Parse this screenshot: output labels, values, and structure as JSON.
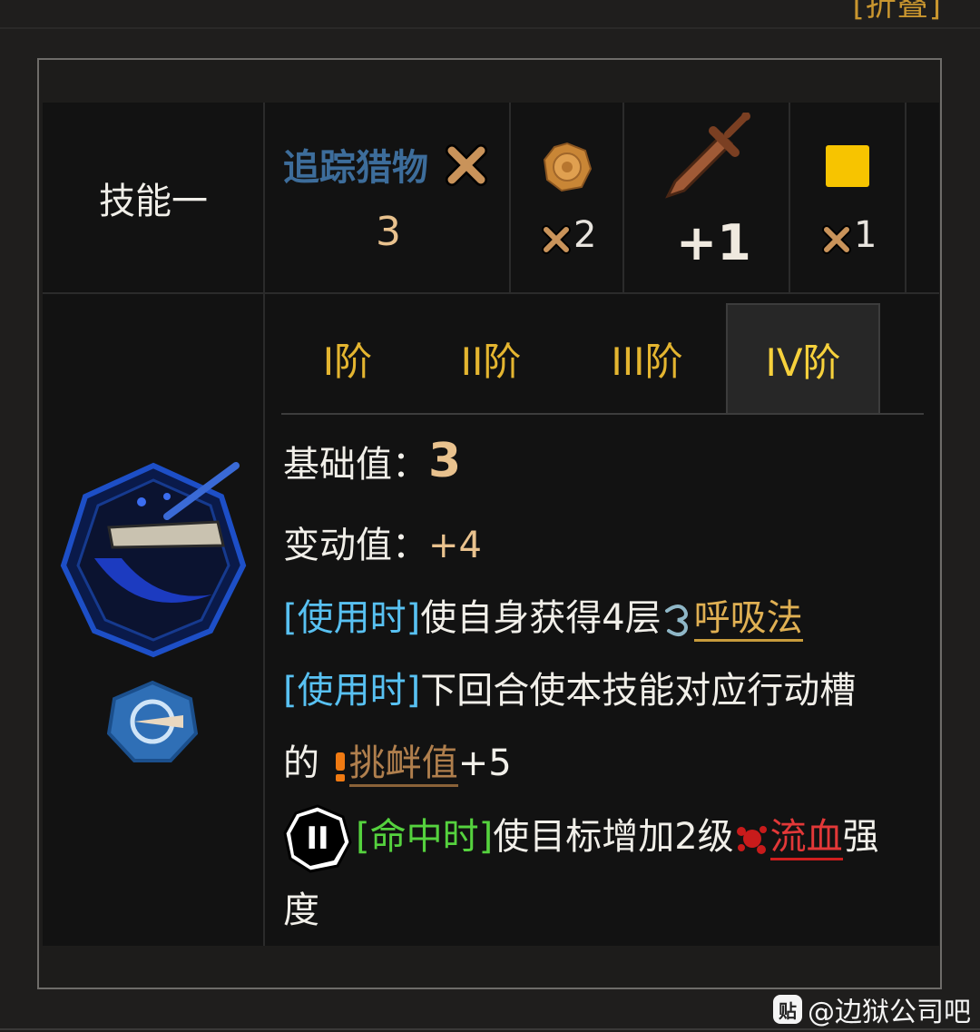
{
  "header": {
    "fold_label": "[折叠]"
  },
  "skill": {
    "title": "技能一",
    "tag": "追踪猎物",
    "tag_value": "3",
    "coin_count": "2",
    "attack_bonus": "+1",
    "slot_count": "1"
  },
  "tabs": [
    {
      "label": "I阶",
      "active": false
    },
    {
      "label": "II阶",
      "active": false
    },
    {
      "label": "III阶",
      "active": false
    },
    {
      "label": "IV阶",
      "active": true
    }
  ],
  "details": {
    "base_label": "基础值：",
    "base_value": "3",
    "var_label": "变动值：",
    "var_value": "+4",
    "line1": {
      "trigger": "[使用时]",
      "text": "使自身获得4层",
      "keyword": "呼吸法"
    },
    "line2": {
      "trigger": "[使用时]",
      "text": "下回合使本技能对应行动槽"
    },
    "line3": {
      "prefix": "的",
      "keyword": "挑衅值",
      "suffix": "+5"
    },
    "line4": {
      "coin_mark": "II",
      "trigger": "[命中时]",
      "text": "使目标增加2级",
      "keyword": "流血",
      "suffix": "强"
    },
    "line5": {
      "text": "度"
    }
  },
  "watermark": {
    "badge": "贴",
    "text": "@边狱公司吧"
  },
  "colors": {
    "background": "#1f1e1d",
    "card": "#121212",
    "gold": "#e9c28e",
    "tab_text": "#e4b530",
    "trigger_blue": "#58c1f2",
    "trigger_green": "#55d23e",
    "bleed_red": "#e23838",
    "slot_yellow": "#f7c400"
  },
  "icons": [
    "cross-icon",
    "coin-icon",
    "sword-icon",
    "skill-slot-icon",
    "breath-icon",
    "taunt-icon",
    "bleed-icon",
    "coin-two-icon",
    "skill-art-icon",
    "skill-type-icon"
  ]
}
